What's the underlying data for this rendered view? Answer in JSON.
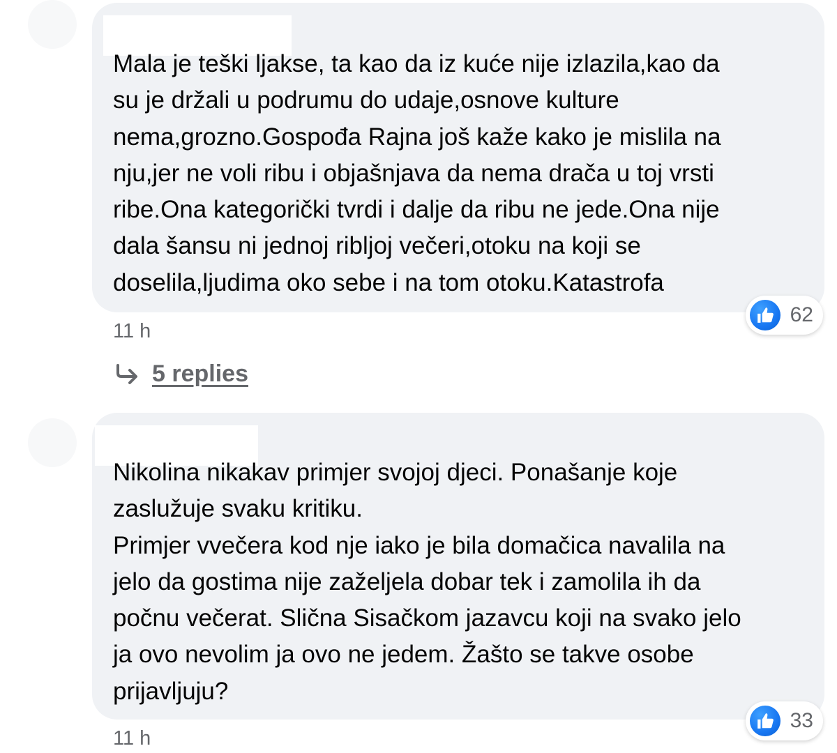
{
  "comments": [
    {
      "text": "Mala je teški ljakse, ta kao da iz kuće nije izlazila,kao da\nsu je držali u podrumu do udaje,osnove kulture\nnema,grozno.Gospođa Rajna još kaže kako je mislila na\nnju,jer ne voli ribu i objašnjava da nema drača u toj vrsti\nribe.Ona kategorički tvrdi i dalje da ribu ne jede.Ona nije\ndala šansu ni jednoj ribljoj večeri,otoku na koji se\ndoselila,ljudima oko sebe i na tom otoku.Katastrofa",
      "reaction_icon": "like-icon",
      "reaction_count": "62",
      "timestamp": "11 h",
      "replies_label": "5 replies"
    },
    {
      "text": "Nikolina nikakav primjer svojoj djeci. Ponašanje koje\nzaslužuje svaku kritiku.\nPrimjer vvečera kod nje iako je bila domačica navalila na\njelo da gostima nije zaželjela dobar tek i zamolila ih da\npočnu večerat. Slična Sisačkom jazavcu koji na svako jelo\nja ovo nevolim ja ovo ne jedem. Žašto se takve osobe\nprijavljuju?",
      "reaction_icon": "like-icon",
      "reaction_count": "33",
      "timestamp": "11 h"
    }
  ],
  "colors": {
    "bubble": "#f0f2f5",
    "text": "#050505",
    "meta": "#65676b",
    "like_blue": "#1877f2"
  }
}
